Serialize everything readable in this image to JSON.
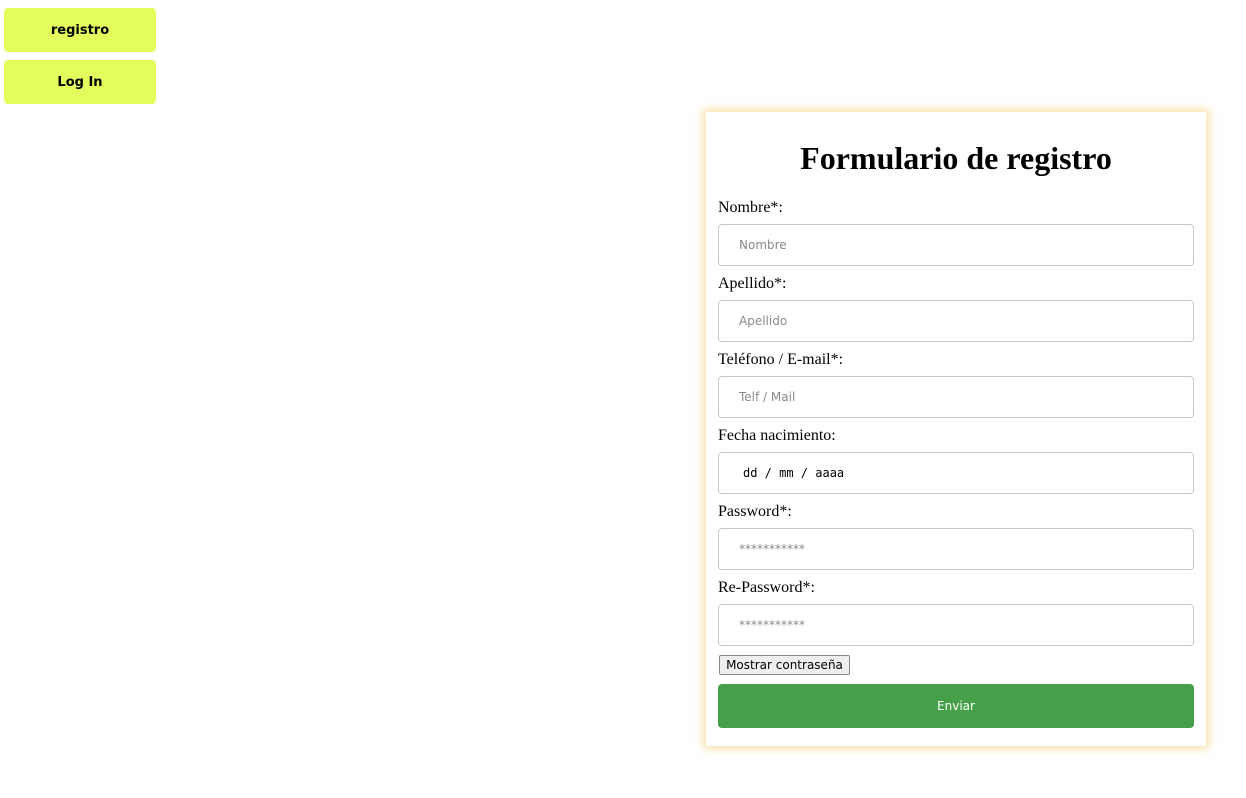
{
  "nav": {
    "registro_label": "registro",
    "login_label": "Log In"
  },
  "form": {
    "title": "Formulario de registro",
    "fields": {
      "nombre": {
        "label": "Nombre*:",
        "placeholder": "Nombre"
      },
      "apellido": {
        "label": "Apellido*:",
        "placeholder": "Apellido"
      },
      "contacto": {
        "label": "Teléfono / E-mail*:",
        "placeholder": "Telf / Mail"
      },
      "fecha": {
        "label": "Fecha nacimiento:",
        "placeholder": "dd / mm / aaaa"
      },
      "password": {
        "label": "Password*:",
        "placeholder": "***********"
      },
      "repassword": {
        "label": "Re-Password*:",
        "placeholder": "***********"
      }
    },
    "show_password_label": "Mostrar contraseña",
    "submit_label": "Enviar"
  },
  "colors": {
    "nav_button": "#e4fc5c",
    "submit_button": "#45a049",
    "card_shadow": "#f0c864"
  }
}
